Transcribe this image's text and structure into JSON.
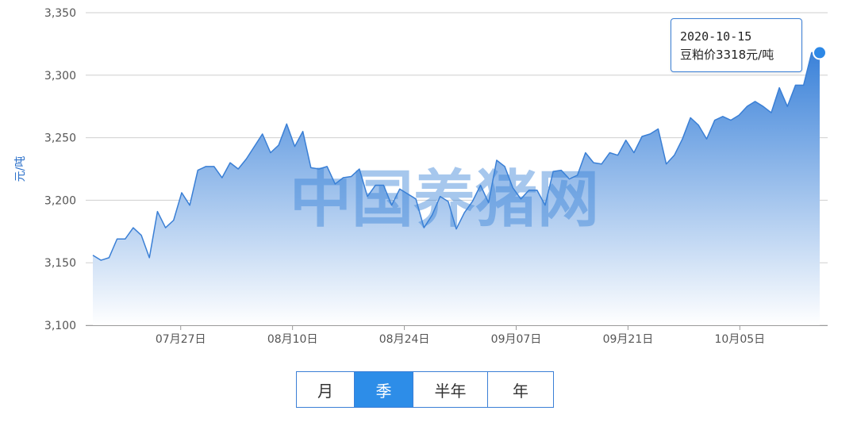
{
  "chart_data": {
    "type": "area",
    "ylabel": "元/吨",
    "ylim": [
      3100,
      3350
    ],
    "yticks": [
      "3,100",
      "3,150",
      "3,200",
      "3,250",
      "3,300",
      "3,350"
    ],
    "x_tick_labels": [
      "07月27日",
      "08月10日",
      "08月24日",
      "09月07日",
      "09月21日",
      "10月05日"
    ],
    "x_tick_dates": [
      "2020-07-27",
      "2020-08-10",
      "2020-08-24",
      "2020-09-07",
      "2020-09-21",
      "2020-10-05"
    ],
    "x_start": "2020-07-16",
    "x_end": "2020-10-15",
    "grid": true,
    "series": [
      {
        "values": [
          3156,
          3152,
          3154,
          3169,
          3169,
          3178,
          3172,
          3154,
          3191,
          3178,
          3184,
          3206,
          3196,
          3224,
          3227,
          3227,
          3218,
          3230,
          3225,
          3233,
          3243,
          3253,
          3238,
          3244,
          3261,
          3243,
          3255,
          3226,
          3225,
          3227,
          3213,
          3218,
          3219,
          3225,
          3203,
          3212,
          3212,
          3196,
          3209,
          3205,
          3201,
          3178,
          3188,
          3203,
          3199,
          3177,
          3190,
          3199,
          3212,
          3198,
          3232,
          3227,
          3210,
          3201,
          3208,
          3208,
          3196,
          3223,
          3224,
          3217,
          3220,
          3238,
          3230,
          3229,
          3238,
          3236,
          3248,
          3238,
          3251,
          3253,
          3257,
          3229,
          3236,
          3249,
          3266,
          3260,
          3249,
          3264,
          3267,
          3264,
          3268,
          3275,
          3279,
          3275,
          3270,
          3290,
          3275,
          3292,
          3292,
          3318,
          3318
        ]
      }
    ],
    "highlight": {
      "date": "2020-10-15",
      "value": 3318
    }
  },
  "tooltip": {
    "date": "2020-10-15",
    "text": "豆粕价3318元/吨"
  },
  "watermark": "中国养猪网",
  "range_tabs": [
    {
      "label": "月",
      "active": false
    },
    {
      "label": "季",
      "active": true
    },
    {
      "label": "半年",
      "active": false
    },
    {
      "label": "年",
      "active": false
    }
  ],
  "colors": {
    "line": "#3a7fd5",
    "area_top": "#3b82d9",
    "area_bottom": "#ffffff",
    "tab_active": "#2d8de8"
  }
}
